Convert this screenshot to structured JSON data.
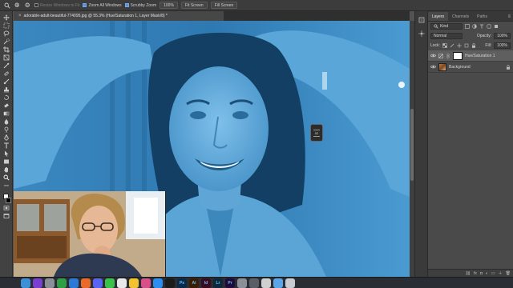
{
  "options_bar": {
    "resize_windows_label": "Resize Windows to Fit",
    "zoom_all_windows_label": "Zoom All Windows",
    "scrubby_zoom_label": "Scrubby Zoom",
    "zoom_percent": "100%",
    "fit_screen_label": "Fit Screen",
    "fill_screen_label": "Fill Screen",
    "resize_windows_checked": false,
    "zoom_all_windows_checked": true,
    "scrubby_zoom_checked": true
  },
  "document": {
    "tab_title": "adorable-adult-beautiful-774095.jpg @ 55.3% (Hue/Saturation 1, Layer Mask/8) *"
  },
  "floating_widget": {
    "label": "02"
  },
  "layers_panel": {
    "tabs": [
      "Layers",
      "Channels",
      "Paths"
    ],
    "active_tab": "Layers",
    "filter_kind": "Kind",
    "blend_mode": "Normal",
    "opacity_label": "Opacity:",
    "opacity_value": "100%",
    "lock_label": "Lock:",
    "fill_label": "Fill:",
    "fill_value": "100%",
    "layers": [
      {
        "name": "Hue/Saturation 1",
        "type": "adjustment",
        "visible": true,
        "active": true
      },
      {
        "name": "Background",
        "type": "pixel",
        "visible": true,
        "active": false,
        "locked": true
      }
    ]
  },
  "dock": {
    "apps": [
      {
        "icon": "finder-icon",
        "color": "#3d8fd6"
      },
      {
        "icon": "siri-icon",
        "color": "#7a3fd0"
      },
      {
        "icon": "launchpad-icon",
        "color": "#8a8f98"
      },
      {
        "icon": "chrome-icon",
        "color": "#2f9e44"
      },
      {
        "icon": "safari-icon",
        "color": "#2b7bd6"
      },
      {
        "icon": "firefox-icon",
        "color": "#e8692a"
      },
      {
        "icon": "discord-icon",
        "color": "#5865f2"
      },
      {
        "icon": "messages-icon",
        "color": "#39c449"
      },
      {
        "icon": "calendar-icon",
        "color": "#e9e9e9"
      },
      {
        "icon": "notes-icon",
        "color": "#f2c230"
      },
      {
        "icon": "photos-icon",
        "color": "#d94f8a"
      },
      {
        "icon": "app-store-icon",
        "color": "#2c8ef0"
      },
      {
        "icon": "terminal-icon",
        "color": "#1c1c1c"
      },
      {
        "icon": "photoshop-icon",
        "color": "#0b2a4a",
        "label": "Ps"
      },
      {
        "icon": "illustrator-icon",
        "color": "#3a1d00",
        "label": "Ai"
      },
      {
        "icon": "indesign-icon",
        "color": "#3b0a1f",
        "label": "Id"
      },
      {
        "icon": "lightroom-icon",
        "color": "#0d2a3c",
        "label": "Lr"
      },
      {
        "icon": "premiere-icon",
        "color": "#1f0b3b",
        "label": "Pr"
      },
      {
        "icon": "system-preferences-icon",
        "color": "#8a8f98"
      },
      {
        "icon": "screenshot-icon",
        "color": "#5a5f66"
      },
      {
        "icon": "preview-icon",
        "color": "#cfcfcf"
      },
      {
        "icon": "folder-icon",
        "color": "#5aa6e8"
      },
      {
        "icon": "trash-icon",
        "color": "#c9cdd3"
      }
    ]
  },
  "colors": {
    "canvas_tint": "#3a8fc4",
    "ui_background": "#535353",
    "panel_background": "#4a4a4a"
  }
}
